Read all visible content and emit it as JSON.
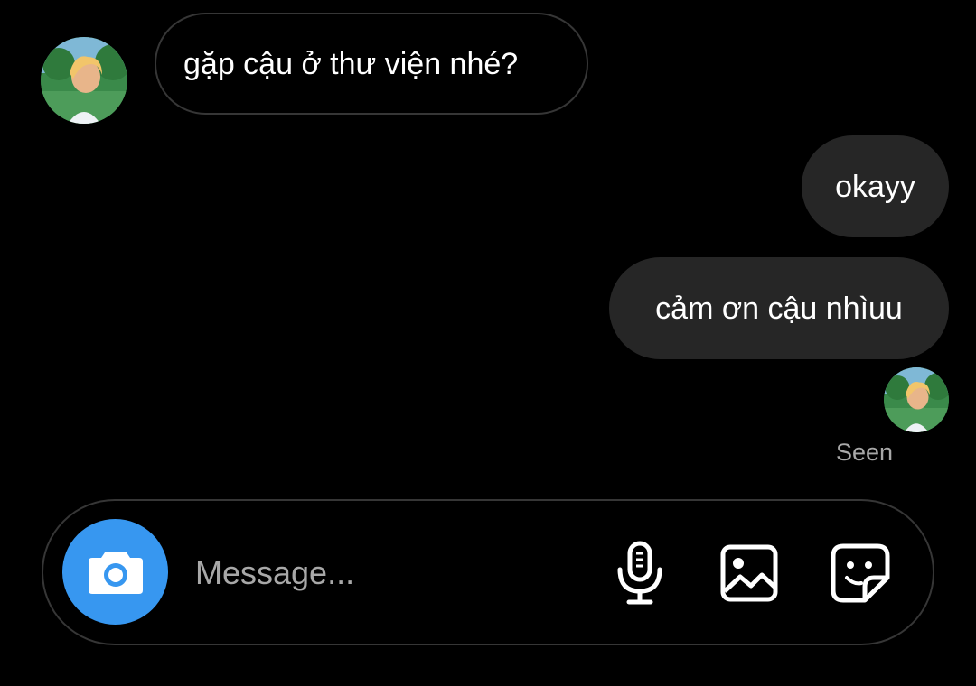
{
  "conversation": {
    "incoming": [
      {
        "text": "gặp cậu ở thư viện nhé?"
      }
    ],
    "outgoing": [
      {
        "text": "okayy"
      },
      {
        "text": "cảm ơn cậu nhìuu"
      }
    ],
    "status": "Seen"
  },
  "composer": {
    "placeholder": "Message...",
    "value": ""
  },
  "icons": {
    "camera": "camera-icon",
    "mic": "microphone-icon",
    "gallery": "image-icon",
    "sticker": "sticker-icon"
  },
  "colors": {
    "background": "#000000",
    "outgoing_bubble": "#262626",
    "border": "#363636",
    "accent": "#3797f0",
    "muted_text": "#a8a8a8"
  }
}
